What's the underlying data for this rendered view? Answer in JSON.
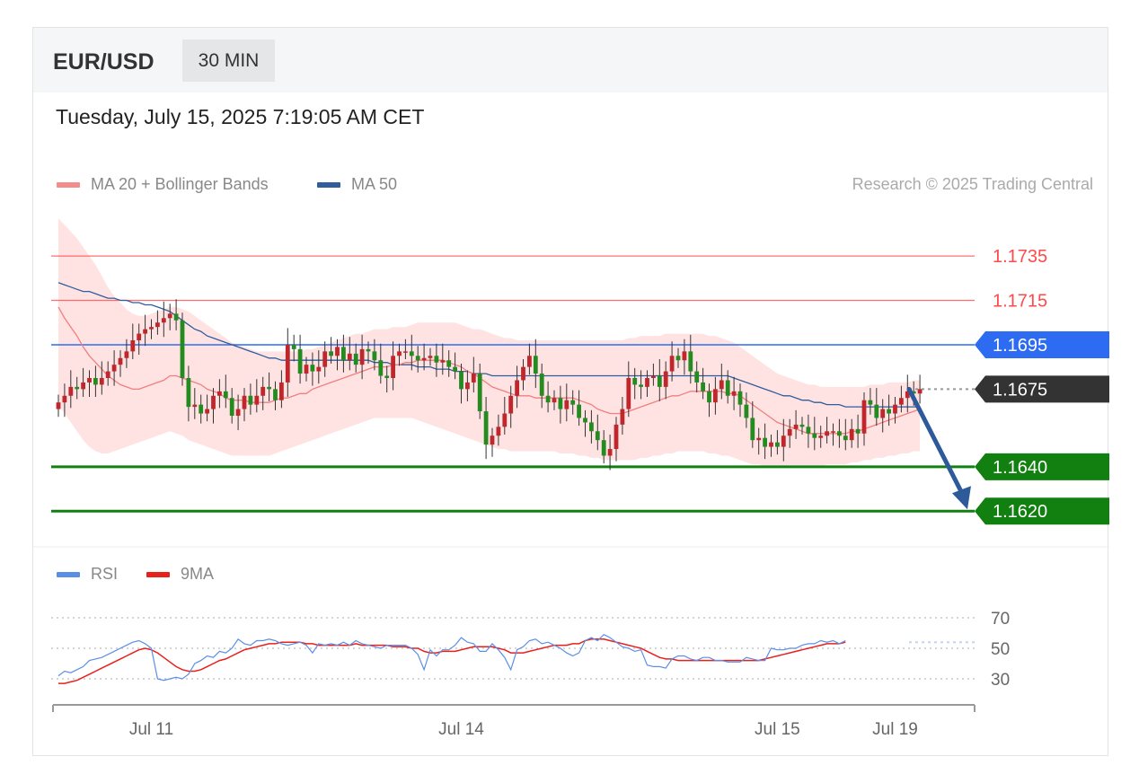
{
  "header": {
    "symbol": "EUR/USD",
    "timeframe": "30 MIN"
  },
  "datetime": "Tuesday, July 15, 2025 7:19:05 AM CET",
  "legend": {
    "bollinger": {
      "label": "MA 20 + Bollinger Bands",
      "color": "#f08a8a"
    },
    "ma50": {
      "label": "MA 50",
      "color": "#2f5d9e"
    }
  },
  "credit": "Research © 2025 Trading Central",
  "rsi_legend": {
    "rsi": {
      "label": "RSI",
      "color": "#5b8fe6"
    },
    "ma9": {
      "label": "9MA",
      "color": "#e8201c"
    }
  },
  "chart_data": {
    "type": "candlestick",
    "ylim": [
      1.1595,
      1.1765
    ],
    "x_ticks": [
      {
        "label": "Jul 11",
        "index": 15
      },
      {
        "label": "Jul 14",
        "index": 65
      },
      {
        "label": "Jul 15",
        "index": 116
      },
      {
        "label": "Jul 19",
        "index": 135
      }
    ],
    "levels": [
      {
        "label": "1.1735",
        "value": 1.1735,
        "kind": "resistance",
        "color": "#ff4a4a"
      },
      {
        "label": "1.1715",
        "value": 1.1715,
        "kind": "resistance",
        "color": "#ff4a4a"
      },
      {
        "label": "1.1695",
        "value": 1.1695,
        "kind": "pivot",
        "color": "#2d6cf2"
      },
      {
        "label": "1.1675",
        "value": 1.1675,
        "kind": "last",
        "color": "#333333"
      },
      {
        "label": "1.1640",
        "value": 1.164,
        "kind": "support",
        "color": "#128010"
      },
      {
        "label": "1.1620",
        "value": 1.162,
        "kind": "support",
        "color": "#128010"
      }
    ],
    "forecast_arrow": {
      "from_value": 1.1675,
      "to_value": 1.162
    },
    "closes": [
      1.1669,
      1.1672,
      1.1676,
      1.1675,
      1.1678,
      1.168,
      1.1677,
      1.168,
      1.1683,
      1.1686,
      1.1689,
      1.1692,
      1.1697,
      1.17,
      1.1702,
      1.1703,
      1.1705,
      1.1707,
      1.1709,
      1.1706,
      1.168,
      1.1667,
      1.1668,
      1.1664,
      1.1666,
      1.1672,
      1.1674,
      1.1671,
      1.1663,
      1.1666,
      1.1672,
      1.1668,
      1.1672,
      1.1676,
      1.1675,
      1.167,
      1.1678,
      1.1695,
      1.1693,
      1.1682,
      1.1686,
      1.1683,
      1.1685,
      1.1692,
      1.169,
      1.1694,
      1.1688,
      1.1691,
      1.1686,
      1.1693,
      1.1692,
      1.1688,
      1.1681,
      1.168,
      1.169,
      1.1692,
      1.1692,
      1.169,
      1.1688,
      1.1689,
      1.169,
      1.1687,
      1.1688,
      1.1685,
      1.1683,
      1.1675,
      1.1678,
      1.1682,
      1.1665,
      1.165,
      1.1654,
      1.1658,
      1.1664,
      1.1672,
      1.1679,
      1.1685,
      1.169,
      1.1682,
      1.1672,
      1.1669,
      1.1671,
      1.1666,
      1.167,
      1.1668,
      1.1662,
      1.166,
      1.1656,
      1.1652,
      1.1645,
      1.1648,
      1.1659,
      1.1666,
      1.168,
      1.1677,
      1.1676,
      1.168,
      1.1681,
      1.1676,
      1.1683,
      1.169,
      1.1688,
      1.1692,
      1.1683,
      1.1678,
      1.1674,
      1.1669,
      1.1675,
      1.1679,
      1.1672,
      1.1674,
      1.1668,
      1.1662,
      1.1652,
      1.1653,
      1.1649,
      1.1651,
      1.1649,
      1.1654,
      1.1657,
      1.1659,
      1.1658,
      1.1655,
      1.1653,
      1.1654,
      1.1656,
      1.1656,
      1.1654,
      1.1652,
      1.1657,
      1.1655,
      1.167,
      1.1668,
      1.1662,
      1.1666,
      1.1664,
      1.1668,
      1.1671,
      1.1674,
      1.1673,
      1.1675
    ],
    "ma20": [
      1.1712,
      1.1707,
      1.1703,
      1.1699,
      1.1694,
      1.169,
      1.1687,
      1.1684,
      1.1681,
      1.1679,
      1.1677,
      1.1676,
      1.1675,
      1.1675,
      1.1676,
      1.1677,
      1.1678,
      1.1679,
      1.1681,
      1.1681,
      1.168,
      1.1679,
      1.1678,
      1.1677,
      1.1675,
      1.1674,
      1.1673,
      1.1671,
      1.167,
      1.167,
      1.167,
      1.1669,
      1.1669,
      1.1669,
      1.1669,
      1.167,
      1.1671,
      1.1671,
      1.1672,
      1.1673,
      1.1673,
      1.1675,
      1.1676,
      1.1677,
      1.1678,
      1.1679,
      1.168,
      1.1681,
      1.1682,
      1.1683,
      1.1684,
      1.1685,
      1.1685,
      1.1685,
      1.1686,
      1.1686,
      1.1687,
      1.1687,
      1.1688,
      1.1688,
      1.1688,
      1.1688,
      1.1688,
      1.1687,
      1.1686,
      1.1685,
      1.1683,
      1.1682,
      1.168,
      1.1678,
      1.1676,
      1.1675,
      1.1674,
      1.1673,
      1.1672,
      1.1672,
      1.1672,
      1.1671,
      1.1671,
      1.1671,
      1.1671,
      1.1671,
      1.1671,
      1.1671,
      1.167,
      1.1669,
      1.1668,
      1.1666,
      1.1665,
      1.1664,
      1.1664,
      1.1664,
      1.1665,
      1.1666,
      1.1667,
      1.1668,
      1.1669,
      1.167,
      1.1671,
      1.1672,
      1.1672,
      1.1673,
      1.1674,
      1.1674,
      1.1674,
      1.1674,
      1.1674,
      1.1674,
      1.1673,
      1.1673,
      1.1672,
      1.167,
      1.1668,
      1.1666,
      1.1664,
      1.1662,
      1.166,
      1.1659,
      1.1658,
      1.1657,
      1.1656,
      1.1655,
      1.1655,
      1.1655,
      1.1655,
      1.1655,
      1.1655,
      1.1655,
      1.1656,
      1.1656,
      1.1657,
      1.1658,
      1.1659,
      1.166,
      1.1661,
      1.1662,
      1.1663,
      1.1664,
      1.1665,
      1.1666
    ],
    "bb_upper": [
      1.1752,
      1.1749,
      1.1746,
      1.1743,
      1.1739,
      1.1735,
      1.1731,
      1.1726,
      1.1721,
      1.1717,
      1.1714,
      1.1711,
      1.1709,
      1.1708,
      1.1708,
      1.1709,
      1.171,
      1.1711,
      1.1712,
      1.1712,
      1.1711,
      1.171,
      1.1708,
      1.1706,
      1.1704,
      1.1702,
      1.17,
      1.1698,
      1.1696,
      1.1695,
      1.1694,
      1.1693,
      1.1692,
      1.1692,
      1.1692,
      1.1692,
      1.1692,
      1.1692,
      1.1692,
      1.1692,
      1.1693,
      1.1693,
      1.1694,
      1.1695,
      1.1696,
      1.1697,
      1.1698,
      1.1699,
      1.17,
      1.17,
      1.1701,
      1.1702,
      1.1702,
      1.1702,
      1.1703,
      1.1703,
      1.1703,
      1.1704,
      1.1705,
      1.1705,
      1.1705,
      1.1705,
      1.1705,
      1.1705,
      1.1705,
      1.1704,
      1.1703,
      1.1702,
      1.1702,
      1.1701,
      1.17,
      1.1699,
      1.1698,
      1.1698,
      1.1697,
      1.1697,
      1.1697,
      1.1697,
      1.1697,
      1.1697,
      1.1697,
      1.1697,
      1.1697,
      1.1697,
      1.1697,
      1.1697,
      1.1697,
      1.1697,
      1.1697,
      1.1697,
      1.1697,
      1.1697,
      1.1698,
      1.1698,
      1.1699,
      1.1699,
      1.1699,
      1.1699,
      1.17,
      1.17,
      1.17,
      1.17,
      1.17,
      1.17,
      1.17,
      1.1699,
      1.1699,
      1.1698,
      1.1697,
      1.1696,
      1.1694,
      1.1692,
      1.169,
      1.1688,
      1.1686,
      1.1684,
      1.1682,
      1.1681,
      1.168,
      1.1679,
      1.1678,
      1.1677,
      1.1677,
      1.1676,
      1.1676,
      1.1676,
      1.1676,
      1.1676,
      1.1676,
      1.1676,
      1.1676,
      1.1677,
      1.1677,
      1.1677,
      1.1678,
      1.1678,
      1.1678,
      1.1678,
      1.1679,
      1.1679
    ],
    "bb_lower": [
      1.1668,
      1.1664,
      1.166,
      1.1656,
      1.1652,
      1.1649,
      1.1647,
      1.1646,
      1.1646,
      1.1647,
      1.1648,
      1.1649,
      1.165,
      1.1651,
      1.1652,
      1.1653,
      1.1654,
      1.1655,
      1.1656,
      1.1655,
      1.1654,
      1.1652,
      1.1651,
      1.165,
      1.1649,
      1.1648,
      1.1647,
      1.1646,
      1.1645,
      1.1645,
      1.1645,
      1.1645,
      1.1645,
      1.1645,
      1.1645,
      1.1646,
      1.1647,
      1.1648,
      1.1649,
      1.165,
      1.1651,
      1.1652,
      1.1653,
      1.1654,
      1.1655,
      1.1656,
      1.1657,
      1.1658,
      1.1659,
      1.166,
      1.1661,
      1.1662,
      1.1662,
      1.1662,
      1.1662,
      1.1662,
      1.1662,
      1.1662,
      1.1661,
      1.166,
      1.1659,
      1.1658,
      1.1657,
      1.1656,
      1.1655,
      1.1654,
      1.1653,
      1.1652,
      1.1651,
      1.165,
      1.1649,
      1.1648,
      1.1648,
      1.1647,
      1.1647,
      1.1647,
      1.1647,
      1.1647,
      1.1647,
      1.1647,
      1.1647,
      1.1646,
      1.1646,
      1.1646,
      1.1645,
      1.1645,
      1.1644,
      1.1644,
      1.1643,
      1.1643,
      1.1643,
      1.1643,
      1.1643,
      1.1643,
      1.1644,
      1.1644,
      1.1645,
      1.1645,
      1.1646,
      1.1646,
      1.1647,
      1.1647,
      1.1647,
      1.1647,
      1.1647,
      1.1646,
      1.1646,
      1.1645,
      1.1645,
      1.1644,
      1.1643,
      1.1642,
      1.1641,
      1.1641,
      1.164,
      1.164,
      1.164,
      1.164,
      1.164,
      1.164,
      1.164,
      1.164,
      1.164,
      1.164,
      1.1641,
      1.1641,
      1.1641,
      1.1641,
      1.1642,
      1.1642,
      1.1643,
      1.1643,
      1.1644,
      1.1644,
      1.1645,
      1.1645,
      1.1646,
      1.1646,
      1.1647,
      1.1647
    ],
    "ma50": [
      1.1723,
      1.1722,
      1.1721,
      1.172,
      1.1719,
      1.1719,
      1.1718,
      1.1717,
      1.1716,
      1.1716,
      1.1715,
      1.1715,
      1.1714,
      1.1714,
      1.1713,
      1.1713,
      1.1712,
      1.1711,
      1.171,
      1.1708,
      1.1706,
      1.1704,
      1.1702,
      1.1701,
      1.1699,
      1.1698,
      1.1697,
      1.1696,
      1.1695,
      1.1694,
      1.1693,
      1.1692,
      1.1691,
      1.169,
      1.1689,
      1.1689,
      1.1688,
      1.1688,
      1.1688,
      1.1688,
      1.1688,
      1.1688,
      1.1688,
      1.1688,
      1.1688,
      1.1688,
      1.1688,
      1.1688,
      1.1688,
      1.1688,
      1.1688,
      1.1687,
      1.1687,
      1.1687,
      1.1686,
      1.1686,
      1.1686,
      1.1686,
      1.1685,
      1.1685,
      1.1685,
      1.1684,
      1.1684,
      1.1684,
      1.1683,
      1.1683,
      1.1683,
      1.1682,
      1.1682,
      1.1682,
      1.1681,
      1.1681,
      1.1681,
      1.1681,
      1.1681,
      1.1681,
      1.1681,
      1.1681,
      1.1681,
      1.1681,
      1.1681,
      1.1681,
      1.1681,
      1.1681,
      1.1681,
      1.1681,
      1.1681,
      1.1681,
      1.1681,
      1.1681,
      1.1681,
      1.1681,
      1.1681,
      1.1681,
      1.1681,
      1.1681,
      1.1681,
      1.1681,
      1.1681,
      1.1681,
      1.1681,
      1.1681,
      1.1681,
      1.1681,
      1.1681,
      1.1681,
      1.1681,
      1.1681,
      1.1681,
      1.168,
      1.1679,
      1.1678,
      1.1677,
      1.1676,
      1.1675,
      1.1674,
      1.1673,
      1.1672,
      1.1672,
      1.1671,
      1.167,
      1.167,
      1.1669,
      1.1669,
      1.1668,
      1.1668,
      1.1668,
      1.1667,
      1.1667,
      1.1667,
      1.1667,
      1.1667,
      1.1667,
      1.1667,
      1.1667,
      1.1667,
      1.1667,
      1.1667,
      1.1667,
      1.1667
    ],
    "rsi": {
      "ylim": [
        20,
        80
      ],
      "levels": [
        {
          "label": "70",
          "value": 70
        },
        {
          "label": "50",
          "value": 50
        },
        {
          "label": "30",
          "value": 30
        }
      ],
      "rsi": [
        32,
        35,
        34,
        36,
        38,
        42,
        43,
        44,
        46,
        48,
        50,
        52,
        54,
        55,
        53,
        50,
        30,
        29,
        30,
        31,
        30,
        33,
        40,
        42,
        45,
        44,
        48,
        47,
        50,
        56,
        53,
        52,
        55,
        55,
        56,
        55,
        53,
        52,
        53,
        54,
        52,
        47,
        53,
        52,
        53,
        52,
        54,
        52,
        55,
        53,
        52,
        51,
        50,
        52,
        52,
        52,
        52,
        50,
        46,
        36,
        49,
        45,
        49,
        49,
        52,
        57,
        54,
        53,
        48,
        48,
        53,
        49,
        44,
        36,
        49,
        51,
        55,
        56,
        53,
        54,
        52,
        50,
        47,
        45,
        47,
        55,
        57,
        55,
        59,
        57,
        54,
        51,
        50,
        48,
        49,
        39,
        38,
        38,
        37,
        43,
        45,
        45,
        43,
        42,
        44,
        44,
        42,
        42,
        41,
        41,
        41,
        44,
        43,
        42,
        42,
        50,
        49,
        49,
        50,
        50,
        52,
        53,
        53,
        55,
        54,
        55,
        53,
        55
      ],
      "ma9": [
        27,
        27,
        28,
        29,
        31,
        33,
        35,
        37,
        39,
        41,
        43,
        45,
        47,
        49,
        50,
        49,
        47,
        44,
        41,
        38,
        36,
        35,
        35,
        36,
        38,
        40,
        42,
        43,
        45,
        47,
        49,
        50,
        51,
        52,
        53,
        53,
        54,
        54,
        54,
        54,
        53,
        53,
        52,
        52,
        52,
        52,
        52,
        52,
        53,
        52,
        52,
        52,
        52,
        52,
        51,
        51,
        51,
        50,
        50,
        48,
        47,
        47,
        48,
        48,
        48,
        49,
        50,
        51,
        51,
        51,
        51,
        50,
        49,
        47,
        47,
        47,
        48,
        49,
        50,
        51,
        52,
        52,
        52,
        53,
        53,
        55,
        56,
        56,
        56,
        55,
        54,
        53,
        52,
        51,
        50,
        48,
        46,
        44,
        43,
        43,
        42,
        42,
        42,
        42,
        42,
        42,
        42,
        42,
        42,
        42,
        42,
        42,
        42,
        42,
        43,
        44,
        45,
        46,
        47,
        48,
        49,
        50,
        51,
        52,
        53,
        53,
        53,
        54
      ]
    }
  }
}
